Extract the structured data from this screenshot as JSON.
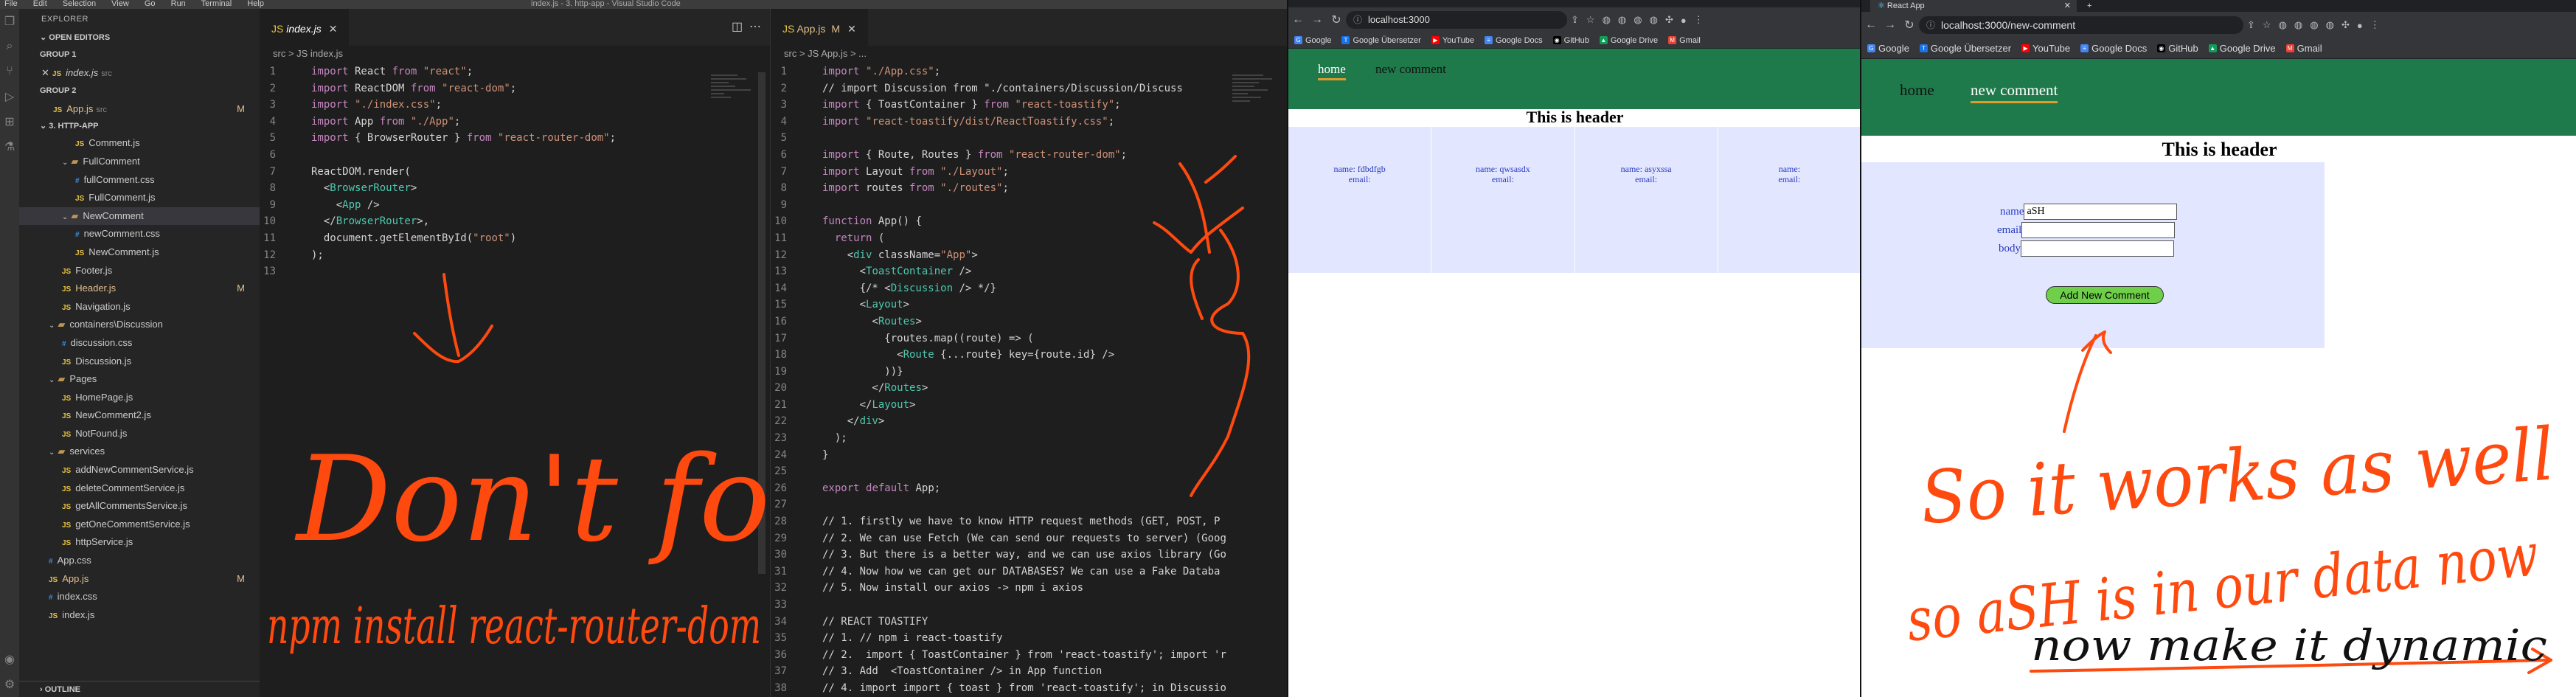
{
  "vscode": {
    "menu": [
      "File",
      "Edit",
      "Selection",
      "View",
      "Go",
      "Run",
      "Terminal",
      "Help"
    ],
    "window_title": "index.js - 3. http-app - Visual Studio Code",
    "sidebar": {
      "title": "EXPLORER",
      "open_editors": "OPEN EDITORS",
      "group1": "GROUP 1",
      "group1_file": "index.js",
      "group1_hint": "src",
      "group2": "GROUP 2",
      "group2_file": "App.js",
      "group2_hint": "src",
      "project": "3. HTTP-APP",
      "outline": "OUTLINE",
      "tree": [
        {
          "label": "Comment.js",
          "kind": "js",
          "indent": 3
        },
        {
          "label": "FullComment",
          "kind": "folder",
          "indent": 2
        },
        {
          "label": "fullComment.css",
          "kind": "css",
          "indent": 3
        },
        {
          "label": "FullComment.js",
          "kind": "js",
          "indent": 3
        },
        {
          "label": "NewComment",
          "kind": "folder",
          "indent": 2
        },
        {
          "label": "newComment.css",
          "kind": "css",
          "indent": 3
        },
        {
          "label": "NewComment.js",
          "kind": "js",
          "indent": 3
        },
        {
          "label": "Footer.js",
          "kind": "js",
          "indent": 2
        },
        {
          "label": "Header.js",
          "kind": "js",
          "indent": 2,
          "mod": "M"
        },
        {
          "label": "Navigation.js",
          "kind": "js",
          "indent": 2
        },
        {
          "label": "containers\\Discussion",
          "kind": "folder",
          "indent": 1
        },
        {
          "label": "discussion.css",
          "kind": "css",
          "indent": 2
        },
        {
          "label": "Discussion.js",
          "kind": "js",
          "indent": 2
        },
        {
          "label": "Pages",
          "kind": "folder",
          "indent": 1
        },
        {
          "label": "HomePage.js",
          "kind": "js",
          "indent": 2
        },
        {
          "label": "NewComment2.js",
          "kind": "js",
          "indent": 2
        },
        {
          "label": "NotFound.js",
          "kind": "js",
          "indent": 2
        },
        {
          "label": "services",
          "kind": "folder",
          "indent": 1
        },
        {
          "label": "addNewCommentService.js",
          "kind": "js",
          "indent": 2
        },
        {
          "label": "deleteCommentService.js",
          "kind": "js",
          "indent": 2
        },
        {
          "label": "getAllCommentsService.js",
          "kind": "js",
          "indent": 2
        },
        {
          "label": "getOneCommentService.js",
          "kind": "js",
          "indent": 2
        },
        {
          "label": "httpService.js",
          "kind": "js",
          "indent": 2
        },
        {
          "label": "App.css",
          "kind": "css",
          "indent": 1
        },
        {
          "label": "App.js",
          "kind": "js",
          "indent": 1,
          "mod": "M"
        },
        {
          "label": "index.css",
          "kind": "css",
          "indent": 1
        },
        {
          "label": "index.js",
          "kind": "js",
          "indent": 1
        }
      ]
    },
    "editor1": {
      "tab": "index.js",
      "breadcrumb": "src > JS index.js",
      "lines": [
        "import React from \"react\";",
        "import ReactDOM from \"react-dom\";",
        "import \"./index.css\";",
        "import App from \"./App\";",
        "import { BrowserRouter } from \"react-router-dom\";",
        "",
        "ReactDOM.render(",
        "  <BrowserRouter>",
        "    <App />",
        "  </BrowserRouter>,",
        "  document.getElementById(\"root\")",
        ");",
        ""
      ]
    },
    "editor2": {
      "tab": "App.js",
      "tab_mod": "M",
      "breadcrumb": "src > JS App.js > ...",
      "lines": [
        "import \"./App.css\";",
        "// import Discussion from \"./containers/Discussion/Discuss",
        "import { ToastContainer } from \"react-toastify\";",
        "import \"react-toastify/dist/ReactToastify.css\";",
        "",
        "import { Route, Routes } from \"react-router-dom\";",
        "import Layout from \"./Layout\";",
        "import routes from \"./routes\";",
        "",
        "function App() {",
        "  return (",
        "    <div className=\"App\">",
        "      <ToastContainer />",
        "      {/* <Discussion /> */}",
        "      <Layout>",
        "        <Routes>",
        "          {routes.map((route) => (",
        "            <Route {...route} key={route.id} />",
        "          ))}",
        "        </Routes>",
        "      </Layout>",
        "    </div>",
        "  );",
        "}",
        "",
        "export default App;",
        "",
        "// 1. firstly we have to know HTTP request methods (GET, POST, P",
        "// 2. We can use Fetch (We can send our requests to server) (Goog",
        "// 3. But there is a better way, and we can use axios library (Go",
        "// 4. Now how we can get our DATABASES? We can use a Fake Databa",
        "// 5. Now install our axios -> npm i axios",
        "",
        "// REACT TOASTIFY",
        "// 1. // npm i react-toastify",
        "// 2.  import { ToastContainer } from 'react-toastify'; import 'r",
        "// 3. Add  <ToastContainer /> in App function",
        "// 4. import import { toast } from 'react-toastify'; in Discussio"
      ]
    },
    "annotations": {
      "dont_forget": "Don't forget",
      "npm_install": "npm install react-router-dom"
    }
  },
  "chrome1": {
    "tabs": [
      "",
      "",
      "",
      "",
      "",
      ""
    ],
    "url": "localhost:3000",
    "bookmarks": [
      "Google",
      "Google Übersetzer",
      "YouTube",
      "Google Docs",
      "GitHub",
      "Google Drive",
      "Gmail"
    ],
    "nav": [
      "home",
      "new comment"
    ],
    "header": "This is header",
    "cards": [
      {
        "name": "name: fdbdfgb",
        "email": "email:"
      },
      {
        "name": "name: qwsasdx",
        "email": "email:"
      },
      {
        "name": "name: asyxssa",
        "email": "email:"
      },
      {
        "name": "name:",
        "email": "email:"
      }
    ]
  },
  "chrome2": {
    "tab_title": "React App",
    "url": "localhost:3000/new-comment",
    "bookmarks": [
      "Google",
      "Google Übersetzer",
      "YouTube",
      "Google Docs",
      "GitHub",
      "Google Drive",
      "Gmail"
    ],
    "nav": [
      "home",
      "new comment"
    ],
    "header": "This is header",
    "form": {
      "name_label": "name",
      "name_value": "aSH",
      "email_label": "email",
      "email_value": "",
      "body_label": "body",
      "body_value": "",
      "button": "Add New Comment"
    },
    "annotations": {
      "line1": "So it works as well",
      "line2": "so aSH is in our data now",
      "line3": "now make it dynamic"
    }
  }
}
